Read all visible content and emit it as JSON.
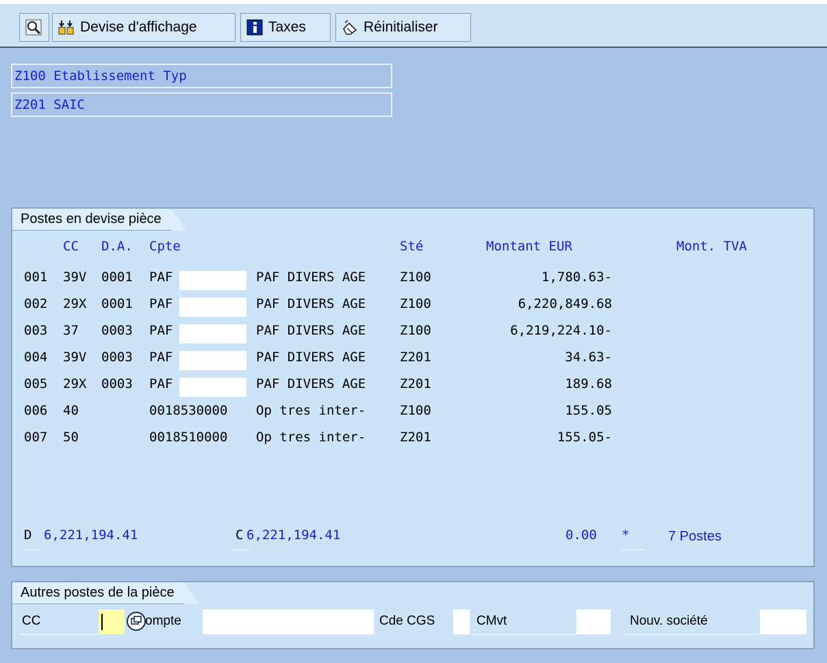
{
  "toolbar": {
    "buttons": [
      {
        "icon": "magnifier-icon",
        "label": ""
      },
      {
        "icon": "currency-icon",
        "label": "Devise d'affichage"
      },
      {
        "icon": "info-icon",
        "label": "Taxes"
      },
      {
        "icon": "reset-icon",
        "label": "Réinitialiser"
      }
    ]
  },
  "header": {
    "line1": "Z100 Etablissement Typ",
    "line2": "Z201 SAIC"
  },
  "items_panel": {
    "title": "Postes en devise pièce",
    "columns": {
      "cc": "CC",
      "da": "D.A.",
      "cpte": "Cpte",
      "ste": "Sté",
      "montant": "Montant EUR",
      "tva": "Mont. TVA"
    },
    "rows": [
      {
        "no": "001",
        "cc": "39V",
        "da": "0001",
        "cpte": "PAF",
        "desc": "PAF DIVERS AGE",
        "ste": "Z100",
        "montant": "1,780.63-"
      },
      {
        "no": "002",
        "cc": "29X",
        "da": "0001",
        "cpte": "PAF",
        "desc": "PAF DIVERS AGE",
        "ste": "Z100",
        "montant": "6,220,849.68"
      },
      {
        "no": "003",
        "cc": "37",
        "da": "0003",
        "cpte": "PAF",
        "desc": "PAF DIVERS AGE",
        "ste": "Z100",
        "montant": "6,219,224.10-"
      },
      {
        "no": "004",
        "cc": "39V",
        "da": "0003",
        "cpte": "PAF",
        "desc": "PAF DIVERS AGE",
        "ste": "Z201",
        "montant": "34.63-"
      },
      {
        "no": "005",
        "cc": "29X",
        "da": "0003",
        "cpte": "PAF",
        "desc": "PAF DIVERS AGE",
        "ste": "Z201",
        "montant": "189.68"
      },
      {
        "no": "006",
        "cc": "40",
        "da": "",
        "cpte": "0018530000",
        "desc": "Op tres inter-",
        "ste": "Z100",
        "montant": "155.05"
      },
      {
        "no": "007",
        "cc": "50",
        "da": "",
        "cpte": "0018510000",
        "desc": "Op tres inter-",
        "ste": "Z201",
        "montant": "155.05-"
      }
    ],
    "totals": {
      "d_label": "D",
      "d_value": "6,221,194.41",
      "c_label": "C",
      "c_value": "6,221,194.41",
      "balance": "0.00",
      "star": "*",
      "count": "7 Postes"
    }
  },
  "other_panel": {
    "title": "Autres postes de la pièce",
    "cc_label": "CC",
    "compte_label": "ompte",
    "cde_cgs_label": "Cde CGS",
    "cmvt_label": "CMvt",
    "nouv_label": "Nouv. société"
  },
  "colors": {
    "text_blue": "#1a1adc",
    "panel_bg": "#cde3f8",
    "screen_bg": "#a7c3e8",
    "input_focus": "#ffffaa"
  }
}
